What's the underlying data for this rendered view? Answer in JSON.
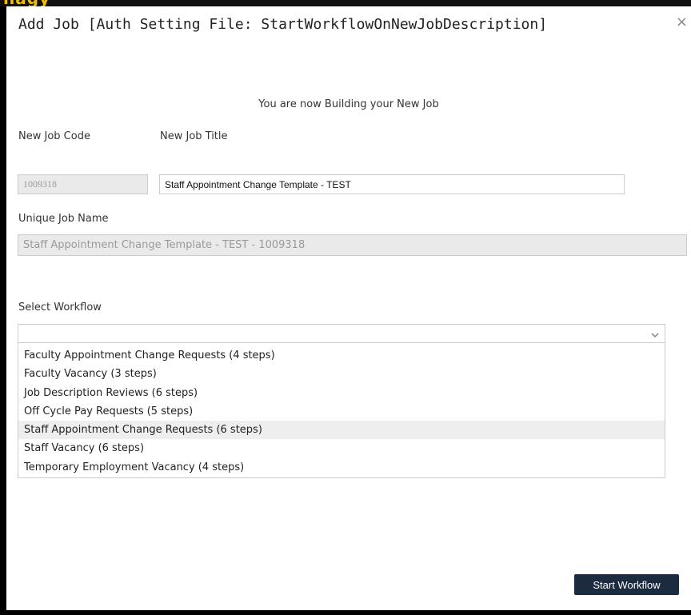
{
  "modal": {
    "title": "Add Job [Auth Setting File: StartWorkflowOnNewJobDescription]",
    "close_glyph": "×",
    "info_text": "You are now Building your New Job"
  },
  "form": {
    "job_code": {
      "label": "New Job Code",
      "value": "1009318"
    },
    "job_title": {
      "label": "New Job Title",
      "value": "Staff Appointment Change Template - TEST"
    },
    "unique_name": {
      "label": "Unique Job Name",
      "value": "Staff Appointment Change Template - TEST - 1009318"
    },
    "workflow": {
      "label": "Select Workflow",
      "selected": "",
      "options": [
        "Faculty Appointment Change Requests (4 steps)",
        "Faculty Vacancy (3 steps)",
        "Job Description Reviews (6 steps)",
        "Off Cycle Pay Requests (5 steps)",
        "Staff Appointment Change Requests (6 steps)",
        "Staff Vacancy (6 steps)",
        "Temporary Employment Vacancy (4 steps)"
      ],
      "highlighted_option": "Staff Appointment Change Requests (6 steps)"
    }
  },
  "actions": {
    "start_label": "Start Workflow"
  },
  "colors": {
    "backdrop": "#000000",
    "primary_button": "#1d2b40",
    "readonly_field": "#eaeaea",
    "border": "#cccccc",
    "hover": "#eeeeee"
  },
  "icons": {
    "close": "close-icon",
    "dropdown": "chevron-down-icon"
  }
}
